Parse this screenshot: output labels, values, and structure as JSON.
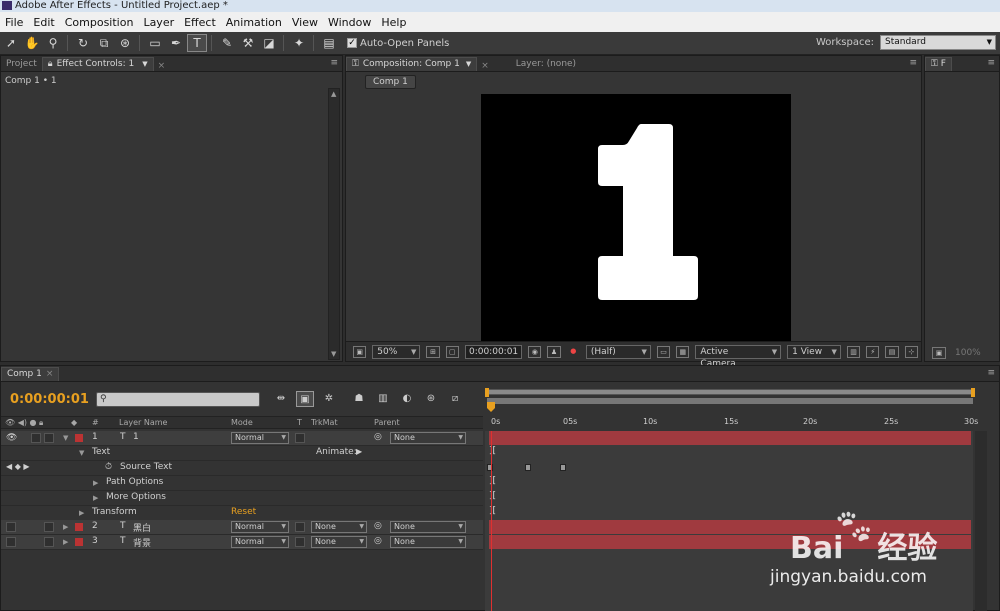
{
  "window": {
    "title": "Adobe After Effects - Untitled Project.aep *"
  },
  "menu": [
    "File",
    "Edit",
    "Composition",
    "Layer",
    "Effect",
    "Animation",
    "View",
    "Window",
    "Help"
  ],
  "toolbar": {
    "auto_open_label": "Auto-Open Panels",
    "auto_open_checked": "✓",
    "workspace_label": "Workspace:",
    "workspace_value": "Standard"
  },
  "left_panel": {
    "tab_project": "Project",
    "tab_effects": "Effect Controls: 1",
    "breadcrumb": "Comp 1 • 1"
  },
  "comp_panel": {
    "tab_comp": "Composition: Comp 1",
    "tab_layer": "Layer: (none)",
    "comp_button": "Comp 1",
    "viewer_glyph": "1"
  },
  "viewer_bar": {
    "zoom": "50%",
    "timecode": "0:00:00:01",
    "resolution": "(Half)",
    "camera": "Active Camera",
    "views": "1 View"
  },
  "right_panel": {
    "zoom": "100%"
  },
  "timeline": {
    "tab": "Comp 1",
    "current_time": "0:00:00:01",
    "headers": {
      "num": "#",
      "layer_name": "Layer Name",
      "mode": "Mode",
      "t": "T",
      "trkmat": "TrkMat",
      "parent": "Parent"
    },
    "ruler_ticks": [
      "0s",
      "05s",
      "10s",
      "15s",
      "20s",
      "25s",
      "30s"
    ],
    "layer1": {
      "num": "1",
      "name": "1",
      "mode": "Normal",
      "parent": "None"
    },
    "text_group": "Text",
    "animate_label": "Animate:",
    "source_text": "Source Text",
    "path_options": "Path Options",
    "more_options": "More Options",
    "transform": "Transform",
    "reset": "Reset",
    "layer2": {
      "num": "2",
      "name": "黑白",
      "mode": "Normal",
      "trkmat": "None",
      "parent": "None"
    },
    "layer3": {
      "num": "3",
      "name": "背景",
      "mode": "Normal",
      "trkmat": "None",
      "parent": "None"
    }
  },
  "watermark": {
    "brand": "Bai",
    "brand2": "经验",
    "url": "jingyan.baidu.com"
  },
  "colors": {
    "timecode": "#e8a020",
    "layer_bar": "#a03a3f",
    "label_red": "#bb3333"
  }
}
